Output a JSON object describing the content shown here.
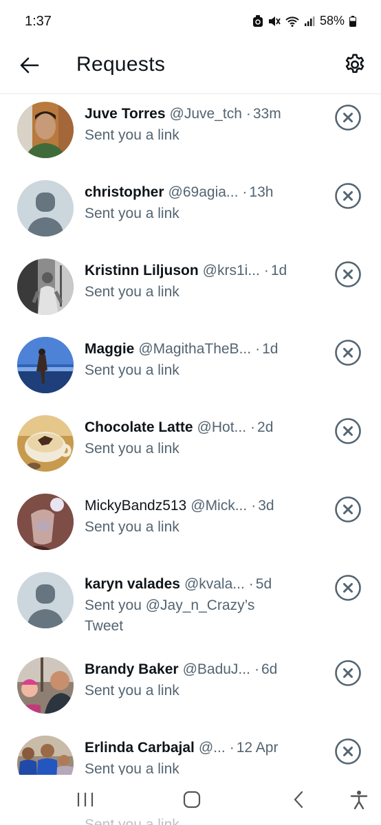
{
  "status_bar": {
    "time": "1:37",
    "battery": "58%"
  },
  "header": {
    "title": "Requests"
  },
  "requests": [
    {
      "name": "Juve Torres",
      "handle": "@Juve_tch",
      "time": "33m",
      "message": "Sent you a link",
      "avatar": "photo-man-green-shirt"
    },
    {
      "name": "christopher",
      "handle": "@69agia...",
      "time": "13h",
      "message": "Sent you a link",
      "avatar": "default"
    },
    {
      "name": "Kristinn Liljuson",
      "handle": "@krs1i...",
      "time": "1d",
      "message": "Sent you a link",
      "avatar": "photo-bw-man"
    },
    {
      "name": "Maggie",
      "handle": "@MagithaTheB...",
      "time": "1d",
      "message": "Sent you a link",
      "avatar": "photo-beach-blue"
    },
    {
      "name": "Chocolate Latte",
      "handle": "@Hot...",
      "time": "2d",
      "message": "Sent you a link",
      "avatar": "photo-latte-cup"
    },
    {
      "name": "MickyBandz513",
      "handle": "@Mick...",
      "time": "3d",
      "message": "Sent you a link",
      "avatar": "photo-mirror-selfie"
    },
    {
      "name": "karyn valades",
      "handle": "@kvala...",
      "time": "5d",
      "message": "Sent you @Jay_n_Crazy’s Tweet",
      "avatar": "default"
    },
    {
      "name": "Brandy Baker",
      "handle": "@BaduJ...",
      "time": "6d",
      "message": "Sent you a link",
      "avatar": "photo-family-selfie"
    },
    {
      "name": "Erlinda Carbajal",
      "handle": "@...",
      "time": "12 Apr",
      "message": "Sent you a link",
      "avatar": "photo-group-blue-jerseys"
    }
  ],
  "peek_text": "Sent you a link",
  "colors": {
    "text_primary": "#0f1419",
    "text_secondary": "#536471",
    "dismiss_icon": "#536471",
    "default_avatar_bg": "#ccd6dd",
    "default_avatar_fg": "#66757f"
  }
}
